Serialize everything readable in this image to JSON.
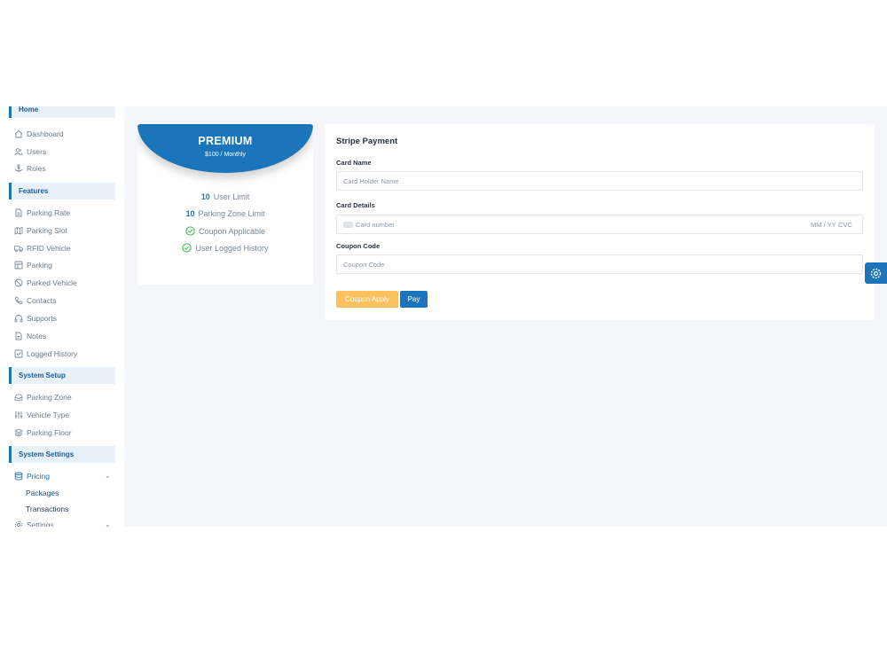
{
  "sidebar": {
    "top_head": "Home",
    "items_main": [
      {
        "label": "Dashboard",
        "icon": "home-icon"
      },
      {
        "label": "Users",
        "icon": "users-icon"
      },
      {
        "label": "Roles",
        "icon": "anchor-icon"
      }
    ],
    "features_head": "Features",
    "items_features": [
      {
        "label": "Parking Rate",
        "icon": "file-icon"
      },
      {
        "label": "Parking Slot",
        "icon": "map-icon"
      },
      {
        "label": "RFID Vehicle",
        "icon": "truck-icon"
      },
      {
        "label": "Parking",
        "icon": "layout-icon"
      },
      {
        "label": "Parked Vehicle",
        "icon": "slash-icon"
      },
      {
        "label": "Contacts",
        "icon": "phone-icon"
      },
      {
        "label": "Supports",
        "icon": "headphones-icon"
      },
      {
        "label": "Notes",
        "icon": "note-icon"
      },
      {
        "label": "Logged History",
        "icon": "check-square-icon"
      }
    ],
    "system_setup_head": "System Setup",
    "items_setup": [
      {
        "label": "Parking Zone",
        "icon": "inbox-icon"
      },
      {
        "label": "Vehicle Type",
        "icon": "sliders-icon"
      },
      {
        "label": "Parking Floor",
        "icon": "layers-icon"
      }
    ],
    "system_settings_head": "System Settings",
    "pricing_label": "Pricing",
    "pricing_sub": [
      "Packages",
      "Transactions"
    ],
    "settings_label": "Settings"
  },
  "plan": {
    "name": "PREMIUM",
    "price": "$100 / Monthly",
    "user_limit_value": "10",
    "user_limit_label": "User Limit",
    "zone_limit_value": "10",
    "zone_limit_label": "Parking Zone Limit",
    "coupon_label": "Coupon Applicable",
    "history_label": "User Logged History"
  },
  "payment": {
    "title": "Stripe Payment",
    "card_name_label": "Card Name",
    "card_name_placeholder": "Card Holder Name",
    "card_details_label": "Card Details",
    "card_number_placeholder": "Card number",
    "card_exp_placeholder": "MM / YY",
    "card_cvc_placeholder": "CVC",
    "coupon_label": "Coupon Code",
    "coupon_placeholder": "Coupon Code",
    "coupon_button": "Coupon Apply",
    "pay_button": "Pay"
  },
  "colors": {
    "brand": "#1b75bb",
    "warning": "#fdc15e",
    "success": "#3ab54a"
  }
}
